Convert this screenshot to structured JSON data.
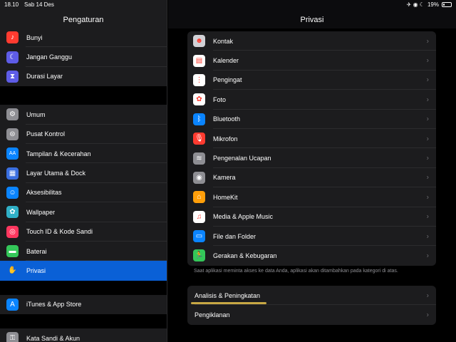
{
  "status": {
    "time": "18.10",
    "date": "Sab 14 Des",
    "icons": "✈ ◉ ☾",
    "battery": "19%",
    "battery_level": 0.19
  },
  "sidebar": {
    "title": "Pengaturan",
    "group1": [
      {
        "label": "Bunyi",
        "icon": "speaker-icon",
        "glyph": "♪",
        "color": "#ff3b30"
      },
      {
        "label": "Jangan Ganggu",
        "icon": "moon-icon",
        "glyph": "☾",
        "color": "#5e5ce6"
      },
      {
        "label": "Durasi Layar",
        "icon": "hourglass-icon",
        "glyph": "⧗",
        "color": "#5e5ce6"
      }
    ],
    "group2": [
      {
        "label": "Umum",
        "icon": "gear-icon",
        "glyph": "⚙",
        "color": "#8e8e93"
      },
      {
        "label": "Pusat Kontrol",
        "icon": "toggles-icon",
        "glyph": "⊜",
        "color": "#8e8e93"
      },
      {
        "label": "Tampilan & Kecerahan",
        "icon": "text-size-icon",
        "glyph": "AA",
        "color": "#0a84ff"
      },
      {
        "label": "Layar Utama & Dock",
        "icon": "home-grid-icon",
        "glyph": "▦",
        "color": "#3a6fe0"
      },
      {
        "label": "Aksesibilitas",
        "icon": "accessibility-icon",
        "glyph": "☺",
        "color": "#0a84ff"
      },
      {
        "label": "Wallpaper",
        "icon": "flower-icon",
        "glyph": "✿",
        "color": "#30b0c7"
      },
      {
        "label": "Touch ID & Kode Sandi",
        "icon": "fingerprint-icon",
        "glyph": "◎",
        "color": "#ff375f"
      },
      {
        "label": "Baterai",
        "icon": "battery-icon",
        "glyph": "▬",
        "color": "#34c759"
      },
      {
        "label": "Privasi",
        "icon": "hand-icon",
        "glyph": "✋",
        "color": "#0a60d6",
        "selected": true
      }
    ],
    "group3": [
      {
        "label": "iTunes & App Store",
        "icon": "app-store-icon",
        "glyph": "A",
        "color": "#0a84ff"
      }
    ],
    "group4": [
      {
        "label": "Kata Sandi & Akun",
        "icon": "key-icon",
        "glyph": "⚿",
        "color": "#8e8e93"
      }
    ]
  },
  "main": {
    "title": "Privasi",
    "items": [
      {
        "label": "Kontak",
        "icon": "contacts-icon",
        "glyph": "☻",
        "color": "#d1d1d6"
      },
      {
        "label": "Kalender",
        "icon": "calendar-icon",
        "glyph": "▤",
        "color": "#ffffff"
      },
      {
        "label": "Pengingat",
        "icon": "reminders-icon",
        "glyph": "⋮",
        "color": "#ffffff"
      },
      {
        "label": "Foto",
        "icon": "photos-icon",
        "glyph": "✿",
        "color": "#ffffff"
      },
      {
        "label": "Bluetooth",
        "icon": "bluetooth-icon",
        "glyph": "ᛒ",
        "color": "#0a84ff"
      },
      {
        "label": "Mikrofon",
        "icon": "microphone-icon",
        "glyph": "🎙",
        "color": "#ff3b30"
      },
      {
        "label": "Pengenalan Ucapan",
        "icon": "waveform-icon",
        "glyph": "≋",
        "color": "#8e8e93"
      },
      {
        "label": "Kamera",
        "icon": "camera-icon",
        "glyph": "◉",
        "color": "#8e8e93"
      },
      {
        "label": "HomeKit",
        "icon": "home-icon",
        "glyph": "⌂",
        "color": "#ff9f0a"
      },
      {
        "label": "Media & Apple Music",
        "icon": "music-icon",
        "glyph": "♫",
        "color": "#ffffff"
      },
      {
        "label": "File dan Folder",
        "icon": "folder-icon",
        "glyph": "▭",
        "color": "#0a84ff"
      },
      {
        "label": "Gerakan & Kebugaran",
        "icon": "fitness-icon",
        "glyph": "🏃",
        "color": "#34c759"
      }
    ],
    "footer_note": "Saat aplikasi meminta akses ke data Anda, aplikasi akan ditambahkan pada kategori di atas.",
    "items2": [
      {
        "label": "Analisis & Peningkatan"
      },
      {
        "label": "Pengiklanan"
      }
    ],
    "chevron": "›"
  }
}
